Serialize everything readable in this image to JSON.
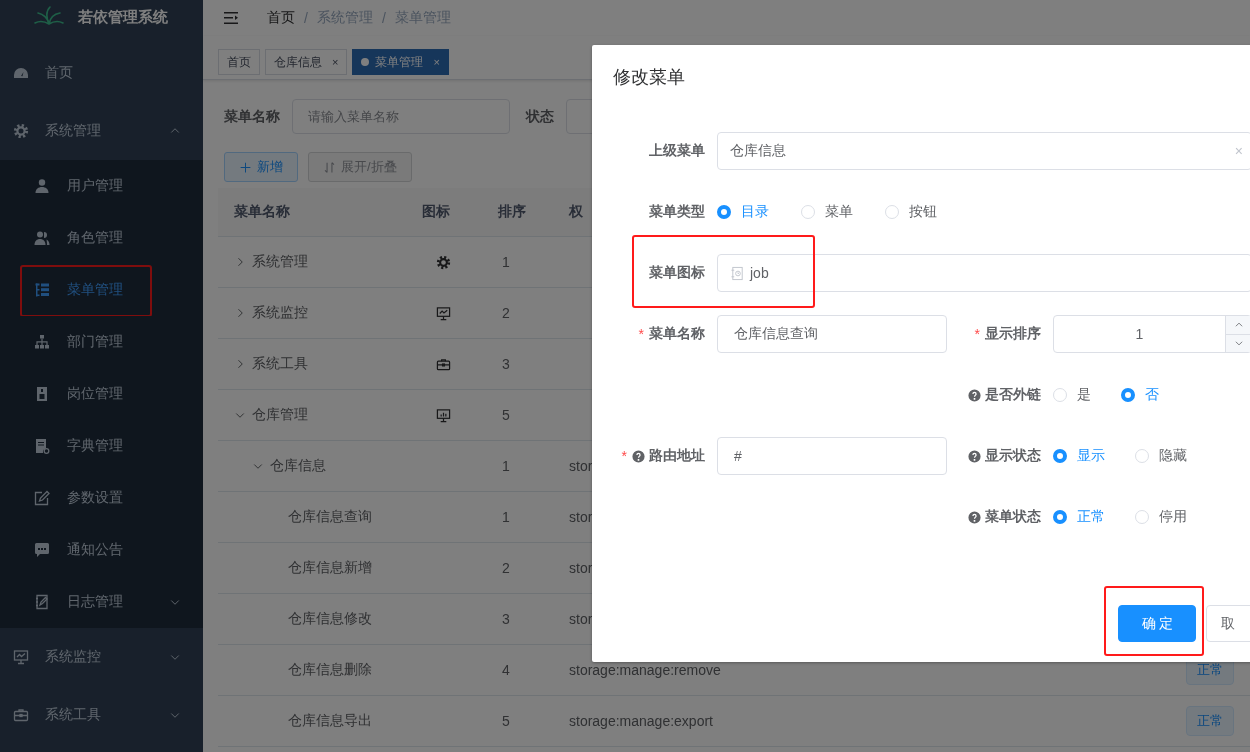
{
  "sidebar": {
    "title": "若依管理系统",
    "items": [
      {
        "label": "首页",
        "selected": false,
        "highlighted": false
      },
      {
        "label": "系统管理",
        "selected": false,
        "highlighted": false,
        "expanded": true,
        "children": [
          {
            "label": "用户管理",
            "selected": false,
            "highlighted": false
          },
          {
            "label": "角色管理",
            "selected": false,
            "highlighted": false
          },
          {
            "label": "菜单管理",
            "selected": true,
            "highlighted": true
          },
          {
            "label": "部门管理",
            "selected": false,
            "highlighted": false
          },
          {
            "label": "岗位管理",
            "selected": false,
            "highlighted": false
          },
          {
            "label": "字典管理",
            "selected": false,
            "highlighted": false
          },
          {
            "label": "参数设置",
            "selected": false,
            "highlighted": false
          },
          {
            "label": "通知公告",
            "selected": false,
            "highlighted": false
          },
          {
            "label": "日志管理",
            "selected": false,
            "highlighted": false,
            "expanded": false
          }
        ]
      },
      {
        "label": "系统监控",
        "selected": false,
        "highlighted": false,
        "expanded": false
      },
      {
        "label": "系统工具",
        "selected": false,
        "highlighted": false,
        "expanded": false
      }
    ]
  },
  "navbar": {
    "breadcrumb": [
      "首页",
      "系统管理",
      "菜单管理"
    ],
    "separator": "/"
  },
  "tags": [
    {
      "label": "首页",
      "selected": false
    },
    {
      "label": "仓库信息",
      "selected": false,
      "close": "×"
    },
    {
      "label": "菜单管理",
      "selected": true,
      "close": "×"
    }
  ],
  "search": [
    {
      "label": "菜单名称",
      "placeholder": "请输入菜单名称"
    },
    {
      "label": "状态"
    }
  ],
  "toolbar": [
    {
      "label": "新增",
      "kind": "primary"
    },
    {
      "label": "展开/折叠",
      "kind": "default"
    }
  ],
  "table": {
    "columns": [
      "菜单名称",
      "图标",
      "排序",
      "权"
    ],
    "rows": [
      {
        "name": "系统管理",
        "order": "1",
        "expanded": false
      },
      {
        "name": "系统监控",
        "order": "2",
        "expanded": false
      },
      {
        "name": "系统工具",
        "order": "3",
        "expanded": false
      },
      {
        "name": "仓库管理",
        "order": "5",
        "expanded": true,
        "children": [
          {
            "name": "仓库信息",
            "order": "1",
            "perm": "stor",
            "expanded": true,
            "children": [
              {
                "name": "仓库信息查询",
                "order": "1",
                "perm": "stor"
              },
              {
                "name": "仓库信息新增",
                "order": "2",
                "perm": "stor"
              },
              {
                "name": "仓库信息修改",
                "order": "3",
                "perm": "stor"
              },
              {
                "name": "仓库信息删除",
                "order": "4",
                "perm": "storage:manage:remove",
                "status": "正常"
              },
              {
                "name": "仓库信息导出",
                "order": "5",
                "perm": "storage:manage:export",
                "status": "正常"
              }
            ]
          }
        ]
      }
    ]
  },
  "dialog": {
    "title": "修改菜单",
    "rows": [
      {
        "full": {
          "label": "上级菜单",
          "kind": "select",
          "value": "仓库信息",
          "clear": "×",
          "help": false,
          "highlighted": false
        }
      },
      {
        "full": {
          "label": "菜单类型",
          "kind": "radio",
          "help": false,
          "highlighted": false,
          "options": [
            {
              "label": "目录",
              "selected": true
            },
            {
              "label": "菜单",
              "selected": false
            },
            {
              "label": "按钮",
              "selected": false
            }
          ]
        }
      },
      {
        "full": {
          "label": "菜单图标",
          "kind": "icon",
          "value": "job",
          "help": false,
          "highlighted": true
        }
      },
      {
        "left": {
          "label": "菜单名称",
          "kind": "input",
          "value": "仓库信息查询",
          "required_mark": "*",
          "help": false,
          "highlighted": false
        },
        "right": {
          "label": "显示排序",
          "kind": "number",
          "value": "1",
          "required_mark": "*",
          "help": false,
          "highlighted": false
        }
      },
      {
        "right": {
          "label": "是否外链",
          "kind": "radio",
          "help": true,
          "highlighted": false,
          "options": [
            {
              "label": "是",
              "selected": false
            },
            {
              "label": "否",
              "selected": true
            }
          ]
        }
      },
      {
        "left": {
          "label": "路由地址",
          "kind": "input",
          "value": "#",
          "required_mark": "*",
          "help": true,
          "highlighted": false
        },
        "right": {
          "label": "显示状态",
          "kind": "radio",
          "help": true,
          "highlighted": false,
          "options": [
            {
              "label": "显示",
              "selected": true
            },
            {
              "label": "隐藏",
              "selected": false
            }
          ]
        }
      },
      {
        "right": {
          "label": "菜单状态",
          "kind": "radio",
          "help": true,
          "highlighted": false,
          "options": [
            {
              "label": "正常",
              "selected": true
            },
            {
              "label": "停用",
              "selected": false
            }
          ]
        }
      }
    ],
    "buttons": [
      {
        "label": "确定",
        "kind": "primary",
        "highlighted": true
      },
      {
        "label": "取",
        "kind": "default",
        "highlighted": false
      }
    ]
  }
}
